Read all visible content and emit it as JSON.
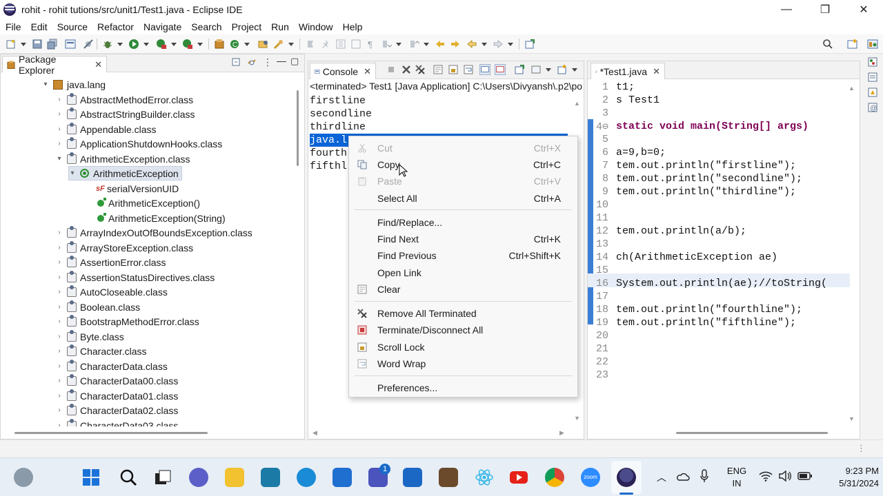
{
  "window": {
    "title": "rohit - rohit tutions/src/unit1/Test1.java - Eclipse IDE",
    "minimize": "—",
    "maximize": "❐",
    "close": "✕"
  },
  "menu": [
    "File",
    "Edit",
    "Source",
    "Refactor",
    "Navigate",
    "Search",
    "Project",
    "Run",
    "Window",
    "Help"
  ],
  "package_explorer": {
    "tab_label": "Package Explorer",
    "close": "✕",
    "tree": [
      {
        "label": "java.lang",
        "type": "package",
        "twisty": "▾"
      },
      {
        "label": "AbstractMethodError.class",
        "type": "class",
        "twisty": "›"
      },
      {
        "label": "AbstractStringBuilder.class",
        "type": "class",
        "twisty": "›"
      },
      {
        "label": "Appendable.class",
        "type": "class",
        "twisty": "›"
      },
      {
        "label": "ApplicationShutdownHooks.class",
        "type": "class",
        "twisty": "›"
      },
      {
        "label": "ArithmeticException.class",
        "type": "class",
        "twisty": "▾"
      },
      {
        "label": "ArithmeticException",
        "type": "type",
        "twisty": "▾"
      },
      {
        "label": "serialVersionUID",
        "type": "field",
        "twisty": ""
      },
      {
        "label": "ArithmeticException()",
        "type": "method",
        "twisty": ""
      },
      {
        "label": "ArithmeticException(String)",
        "type": "method",
        "twisty": ""
      },
      {
        "label": "ArrayIndexOutOfBoundsException.class",
        "type": "class",
        "twisty": "›"
      },
      {
        "label": "ArrayStoreException.class",
        "type": "class",
        "twisty": "›"
      },
      {
        "label": "AssertionError.class",
        "type": "class",
        "twisty": "›"
      },
      {
        "label": "AssertionStatusDirectives.class",
        "type": "class",
        "twisty": "›"
      },
      {
        "label": "AutoCloseable.class",
        "type": "class",
        "twisty": "›"
      },
      {
        "label": "Boolean.class",
        "type": "class",
        "twisty": "›"
      },
      {
        "label": "BootstrapMethodError.class",
        "type": "class",
        "twisty": "›"
      },
      {
        "label": "Byte.class",
        "type": "class",
        "twisty": "›"
      },
      {
        "label": "Character.class",
        "type": "class",
        "twisty": "›"
      },
      {
        "label": "CharacterData.class",
        "type": "class",
        "twisty": "›"
      },
      {
        "label": "CharacterData00.class",
        "type": "class",
        "twisty": "›"
      },
      {
        "label": "CharacterData01.class",
        "type": "class",
        "twisty": "›"
      },
      {
        "label": "CharacterData02.class",
        "type": "class",
        "twisty": "›"
      },
      {
        "label": "CharacterData03.class",
        "type": "class",
        "twisty": "›"
      }
    ]
  },
  "console": {
    "tab_label": "Console",
    "close": "✕",
    "header": "<terminated> Test1 [Java Application] C:\\Users\\Divyansh\\.p2\\po",
    "lines": [
      "firstline",
      "secondline",
      "thirdline",
      "java.l",
      "fourth",
      "fifthl"
    ]
  },
  "editor": {
    "tab_label": "*Test1.java",
    "close": "✕",
    "lines": [
      {
        "n": "1",
        "text": "t1;"
      },
      {
        "n": "2",
        "text": "s Test1"
      },
      {
        "n": "3",
        "text": ""
      },
      {
        "n": "4⊖",
        "text": " static void main(String[] args)"
      },
      {
        "n": "5",
        "text": ""
      },
      {
        "n": "6",
        "text": " a=9,b=0;"
      },
      {
        "n": "7",
        "text": "tem.out.println(\"firstline\");"
      },
      {
        "n": "8",
        "text": "tem.out.println(\"secondline\");"
      },
      {
        "n": "9",
        "text": "tem.out.println(\"thirdline\");"
      },
      {
        "n": "10",
        "text": ""
      },
      {
        "n": "11",
        "text": ""
      },
      {
        "n": "12",
        "text": "tem.out.println(a/b);"
      },
      {
        "n": "13",
        "text": ""
      },
      {
        "n": "14",
        "text": "ch(ArithmeticException ae)"
      },
      {
        "n": "15",
        "text": ""
      },
      {
        "n": "16",
        "text": " System.out.println(ae);//toString("
      },
      {
        "n": "17",
        "text": ""
      },
      {
        "n": "18",
        "text": "tem.out.println(\"fourthline\");"
      },
      {
        "n": "19",
        "text": "tem.out.println(\"fifthline\");"
      },
      {
        "n": "20",
        "text": ""
      },
      {
        "n": "21",
        "text": ""
      },
      {
        "n": "22",
        "text": ""
      },
      {
        "n": "23",
        "text": ""
      }
    ]
  },
  "context_menu": {
    "items": [
      {
        "label": "Cut",
        "accel": "Ctrl+X",
        "disabled": true,
        "icon": "cut-icon"
      },
      {
        "label": "Copy",
        "accel": "Ctrl+C",
        "disabled": false,
        "icon": "copy-icon"
      },
      {
        "label": "Paste",
        "accel": "Ctrl+V",
        "disabled": true,
        "icon": "paste-icon"
      },
      {
        "label": "Select All",
        "accel": "Ctrl+A",
        "disabled": false,
        "icon": ""
      },
      {
        "label": "Find/Replace...",
        "accel": "",
        "disabled": false,
        "icon": ""
      },
      {
        "label": "Find Next",
        "accel": "Ctrl+K",
        "disabled": false,
        "icon": ""
      },
      {
        "label": "Find Previous",
        "accel": "Ctrl+Shift+K",
        "disabled": false,
        "icon": ""
      },
      {
        "label": "Open Link",
        "accel": "",
        "disabled": false,
        "icon": ""
      },
      {
        "label": "Clear",
        "accel": "",
        "disabled": false,
        "icon": "clear-icon"
      },
      {
        "label": "Remove All Terminated",
        "accel": "",
        "disabled": false,
        "icon": "remove-all-icon"
      },
      {
        "label": "Terminate/Disconnect All",
        "accel": "",
        "disabled": false,
        "icon": "terminate-icon"
      },
      {
        "label": "Scroll Lock",
        "accel": "",
        "disabled": false,
        "icon": "scroll-lock-icon"
      },
      {
        "label": "Word Wrap",
        "accel": "",
        "disabled": false,
        "icon": "word-wrap-icon"
      },
      {
        "label": "Preferences...",
        "accel": "",
        "disabled": false,
        "icon": ""
      }
    ]
  },
  "taskbar": {
    "language": "ENG",
    "region": "IN",
    "time": "9:23 PM",
    "date": "5/31/2024",
    "teams_badge": "1",
    "zoom_label": "zoom"
  },
  "colors": {
    "selection": "#0a64d6",
    "keyword": "#7f0055",
    "string": "#2a00ff",
    "static_field": "#0000c0",
    "accent": "#1b6ac9"
  }
}
